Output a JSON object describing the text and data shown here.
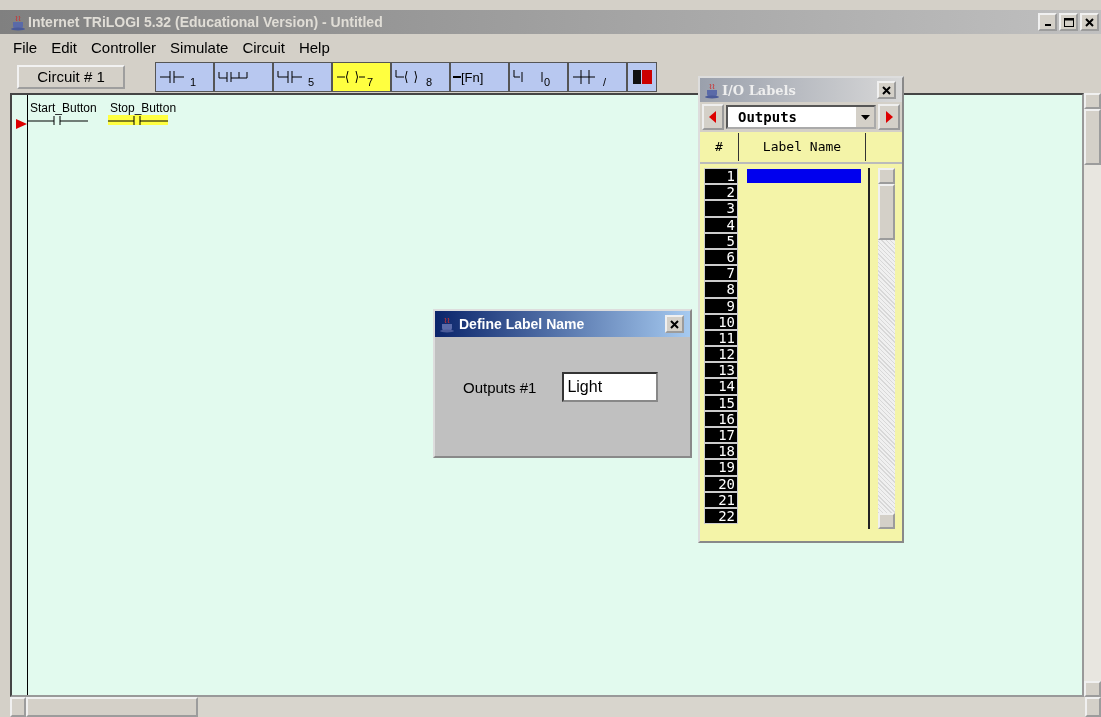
{
  "window": {
    "title": "Internet TRiLOGI 5.32 (Educational Version) - Untitled"
  },
  "menu": [
    "File",
    "Edit",
    "Controller",
    "Simulate",
    "Circuit",
    "Help"
  ],
  "circuit_tab": {
    "label": "Circuit # 1"
  },
  "toolbar": [
    {
      "kind": "contact",
      "sub": "1",
      "selected": false
    },
    {
      "kind": "parallel",
      "selected": false
    },
    {
      "kind": "branch",
      "sub": "5",
      "selected": false
    },
    {
      "kind": "coil",
      "sub": "7",
      "selected": true
    },
    {
      "kind": "branchcoil",
      "sub": "8",
      "selected": false
    },
    {
      "kind": "fn",
      "text": "[Fn]",
      "selected": false
    },
    {
      "kind": "branchfn",
      "sub": "0",
      "selected": false
    },
    {
      "kind": "invert",
      "sub": "/",
      "selected": false
    },
    {
      "kind": "dark",
      "selected": false
    }
  ],
  "ladder": {
    "labels": [
      "Start_Button",
      "Stop_Button"
    ]
  },
  "io_labels": {
    "title": "I/O Labels",
    "category": "Outputs",
    "columns": [
      "#",
      "Label Name"
    ],
    "rows": [
      {
        "number": "1",
        "selected": true
      },
      {
        "number": "2",
        "selected": false
      },
      {
        "number": "3",
        "selected": false
      },
      {
        "number": "4",
        "selected": false
      },
      {
        "number": "5",
        "selected": false
      },
      {
        "number": "6",
        "selected": false
      },
      {
        "number": "7",
        "selected": false
      },
      {
        "number": "8",
        "selected": false
      },
      {
        "number": "9",
        "selected": false
      },
      {
        "number": "10",
        "selected": false
      },
      {
        "number": "11",
        "selected": false
      },
      {
        "number": "12",
        "selected": false
      },
      {
        "number": "13",
        "selected": false
      },
      {
        "number": "14",
        "selected": false
      },
      {
        "number": "15",
        "selected": false
      },
      {
        "number": "16",
        "selected": false
      },
      {
        "number": "17",
        "selected": false
      },
      {
        "number": "18",
        "selected": false
      },
      {
        "number": "19",
        "selected": false
      },
      {
        "number": "20",
        "selected": false
      },
      {
        "number": "21",
        "selected": false
      },
      {
        "number": "22",
        "selected": false
      }
    ]
  },
  "dialog": {
    "title": "Define Label Name",
    "label": "Outputs #1",
    "value": "Light"
  }
}
